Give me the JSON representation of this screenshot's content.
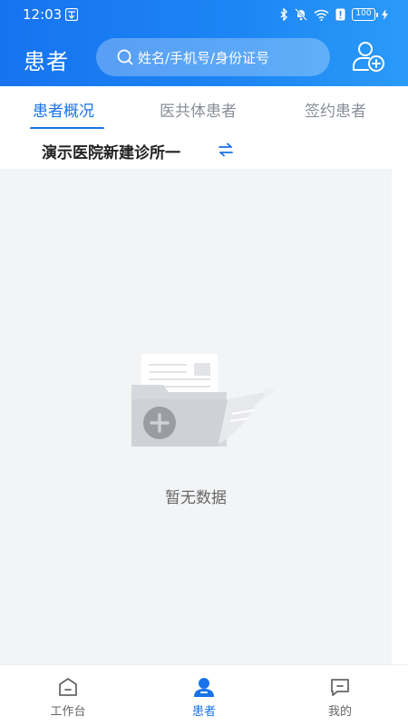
{
  "status_bar": {
    "time": "12:03",
    "battery": "100"
  },
  "header": {
    "title": "患者",
    "search_placeholder": "姓名/手机号/身份证号"
  },
  "tabs": [
    {
      "label": "患者概况",
      "active": true
    },
    {
      "label": "医共体患者",
      "active": false
    },
    {
      "label": "签约患者",
      "active": false
    }
  ],
  "institution": {
    "name": "演示医院新建诊所一"
  },
  "empty_state": {
    "text": "暂无数据"
  },
  "bottom_nav": [
    {
      "label": "工作台",
      "icon": "workbench-icon",
      "active": false
    },
    {
      "label": "患者",
      "icon": "patient-icon",
      "active": true
    },
    {
      "label": "我的",
      "icon": "message-icon",
      "active": false
    }
  ],
  "colors": {
    "primary": "#1a73e8",
    "header_start": "#1673f0",
    "header_end": "#2a9bf8",
    "content_bg": "#f3f4f6"
  }
}
